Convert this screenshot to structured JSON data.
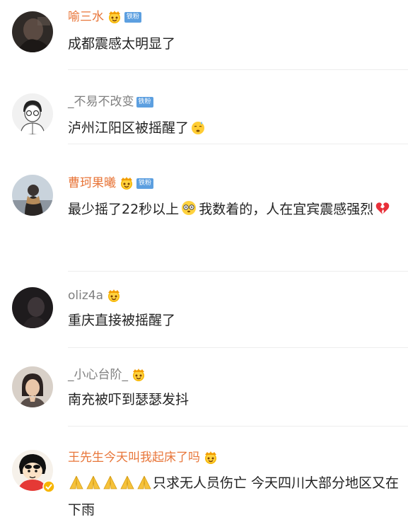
{
  "comments": [
    {
      "username": "喻三水",
      "name_style": "orange",
      "vip": true,
      "fan_badge": true,
      "text": "成都震感太明显了"
    },
    {
      "username": "_不易不改变",
      "name_style": "gray",
      "vip": false,
      "fan_badge": true,
      "text": "泸州江阳区被摇醒了"
    },
    {
      "username": "曹珂果曦",
      "name_style": "orange",
      "vip": true,
      "fan_badge": true,
      "text_parts": [
        "最少摇了22秒以上",
        "我数着的，人在宜宾震感强烈"
      ]
    },
    {
      "username": "oliz4a",
      "name_style": "gray",
      "vip": true,
      "fan_badge": false,
      "text": "重庆直接被摇醒了"
    },
    {
      "username": "_小心台阶_",
      "name_style": "gray",
      "vip": true,
      "fan_badge": false,
      "text": "南充被吓到瑟瑟发抖"
    },
    {
      "username": "王先生今天叫我起床了吗",
      "name_style": "orange",
      "vip": true,
      "fan_badge": false,
      "text": "只求无人员伤亡  今天四川大部分地区又在下雨"
    }
  ],
  "fan_badge_label": "铁粉",
  "icons": {
    "vip": "vip-crown-face-icon",
    "emoji_1": "sleepy-face-emoji-icon",
    "emoji_2": "dizzy-face-emoji-icon",
    "emoji_3": "broken-heart-emoji-icon",
    "emoji_4": "praying-hands-emoji-icon",
    "verified": "verified-badge-icon"
  },
  "colors": {
    "username_orange": "#e8763a",
    "username_gray": "#808080",
    "fan_badge_bg": "#5c9fe0",
    "text": "#222222",
    "divider": "#ededed"
  }
}
